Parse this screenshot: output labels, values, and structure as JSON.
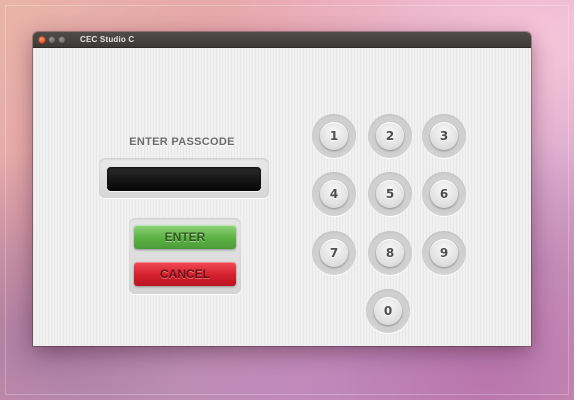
{
  "window": {
    "title": "CEC Studio C"
  },
  "passcode": {
    "label": "ENTER PASSCODE",
    "value": "",
    "placeholder": ""
  },
  "actions": {
    "enter_label": "ENTER",
    "cancel_label": "CANCEL"
  },
  "keypad": {
    "keys": [
      "1",
      "2",
      "3",
      "4",
      "5",
      "6",
      "7",
      "8",
      "9",
      "0"
    ]
  },
  "colors": {
    "enter_button": "#5bb043",
    "cancel_button": "#d41f2d",
    "passcode_field": "#111111",
    "close_button": "#e0502a"
  },
  "icons": {
    "close": "close-icon",
    "minimize": "minimize-icon",
    "maximize": "maximize-icon"
  }
}
